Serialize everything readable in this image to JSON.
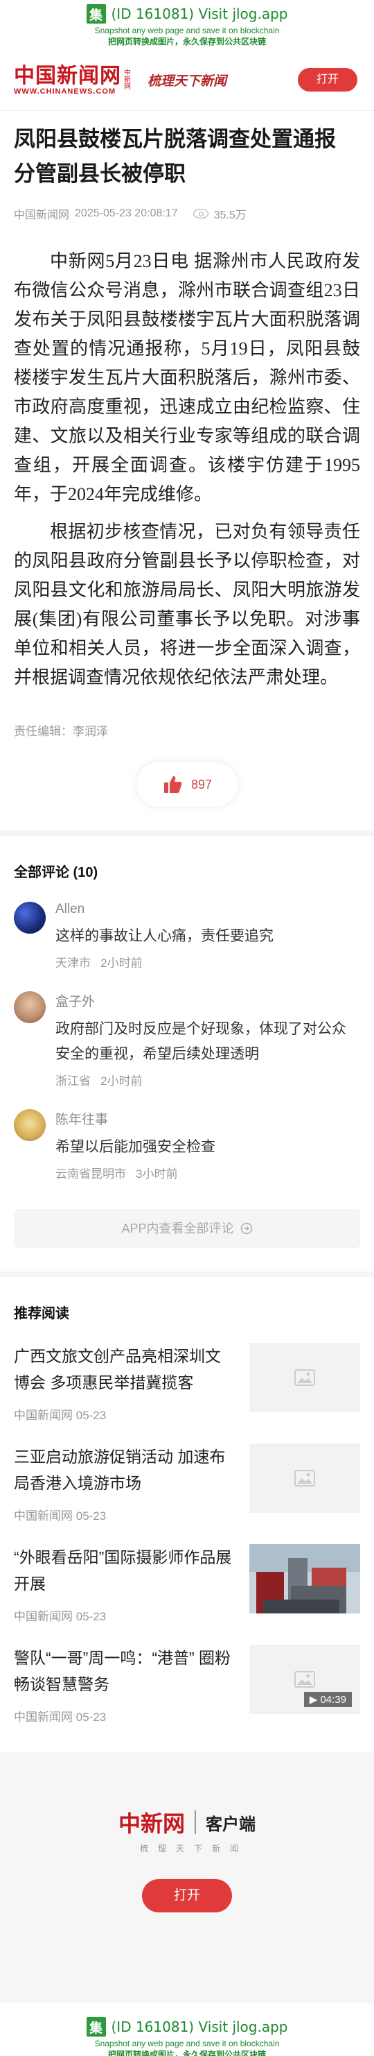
{
  "jlog_banner": {
    "badge": "集",
    "title": "(ID 161081) Visit jlog.app",
    "subtitle_en": "Snapshot any web page and save it on blockchain",
    "subtitle_cn": "把网页转换成图片，永久保存到公共区块链"
  },
  "header": {
    "logo_text": "中国新闻网",
    "logo_url": "WWW.CHINANEWS.COM",
    "logo_side": "中新网",
    "slogan": "梳理天下新闻",
    "open_label": "打开"
  },
  "article": {
    "title": "凤阳县鼓楼瓦片脱落调查处置通报 分管副县长被停职",
    "source": "中国新闻网",
    "datetime": "2025-05-23 20:08:17",
    "views": "35.5万",
    "paragraphs": [
      "中新网5月23日电 据滁州市人民政府发布微信公众号消息，滁州市联合调查组23日发布关于凤阳县鼓楼楼宇瓦片大面积脱落调查处置的情况通报称，5月19日，凤阳县鼓楼楼宇发生瓦片大面积脱落后，滁州市委、市政府高度重视，迅速成立由纪检监察、住建、文旅以及相关行业专家等组成的联合调查组，开展全面调查。该楼宇仿建于1995年，于2024年完成维修。",
      "根据初步核查情况，已对负有领导责任的凤阳县政府分管副县长予以停职检查，对凤阳县文化和旅游局局长、凤阳大明旅游发展(集团)有限公司董事长予以免职。对涉事单位和相关人员，将进一步全面深入调查，并根据调查情况依规依纪依法严肃处理。"
    ],
    "editor": "责任编辑：李润泽",
    "likes": "897"
  },
  "comments": {
    "heading": "全部评论 (10)",
    "items": [
      {
        "user": "Allen",
        "text": "这样的事故让人心痛，责任要追究",
        "location": "天津市",
        "time": "2小时前"
      },
      {
        "user": "盒子外",
        "text": "政府部门及时反应是个好现象，体现了对公众安全的重视，希望后续处理透明",
        "location": "浙江省",
        "time": "2小时前"
      },
      {
        "user": "陈年往事",
        "text": "希望以后能加强安全检查",
        "location": "云南省昆明市",
        "time": "3小时前"
      }
    ],
    "more_label": "APP内查看全部评论"
  },
  "recommend": {
    "heading": "推荐阅读",
    "items": [
      {
        "title": "广西文旅文创产品亮相深圳文博会 多项惠民举措冀揽客",
        "source": "中国新闻网",
        "date": "05-23"
      },
      {
        "title": "三亚启动旅游促销活动 加速布局香港入境游市场",
        "source": "中国新闻网",
        "date": "05-23"
      },
      {
        "title": "“外眼看岳阳”国际摄影师作品展开展",
        "source": "中国新闻网",
        "date": "05-23"
      },
      {
        "title": "警队“一哥”周一鸣：“港普” 圈粉 畅谈智慧警务",
        "source": "中国新闻网",
        "date": "05-23",
        "duration": "04:39"
      }
    ]
  },
  "footer": {
    "brand": "中新网",
    "client": "客户端",
    "tagline": "梳理天下新闻",
    "open_label": "打开"
  },
  "colors": {
    "brand_red": "#c8161d",
    "button_red": "#e03a3a",
    "jlog_green": "#2e9a3c"
  }
}
